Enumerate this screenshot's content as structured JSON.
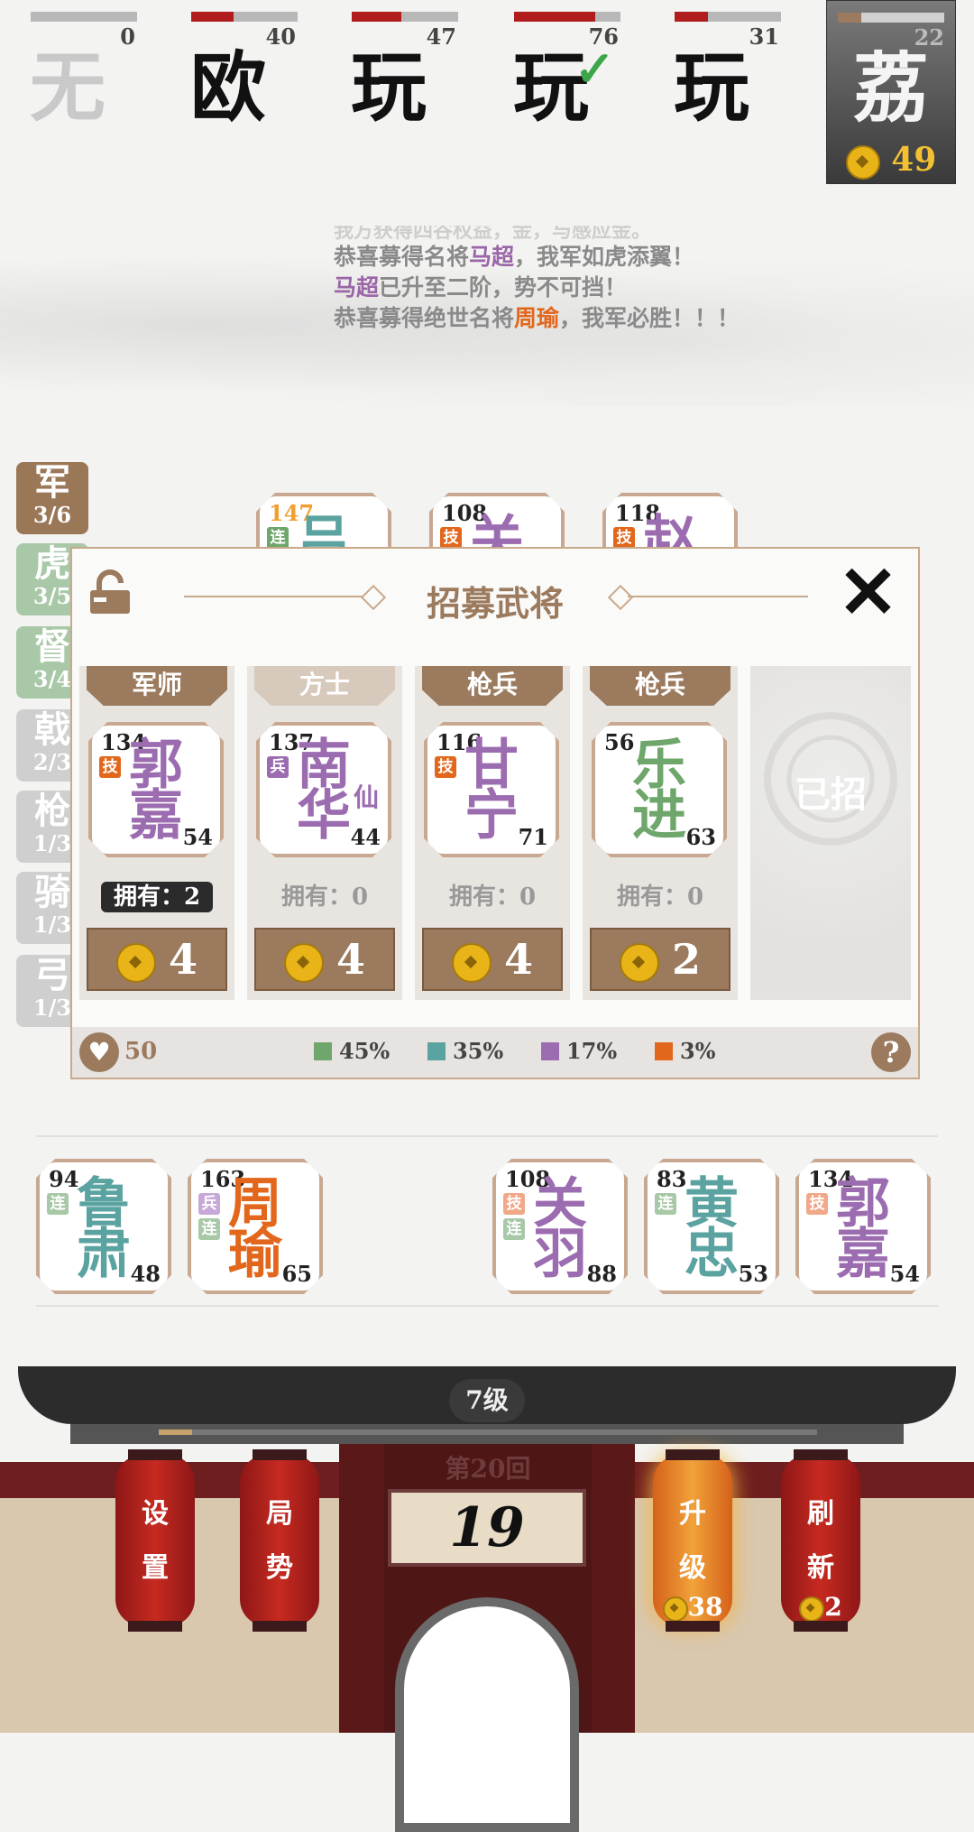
{
  "players": [
    {
      "hp": 0,
      "hp_pct": 0.0,
      "name": "无",
      "dim": true,
      "check": false
    },
    {
      "hp": 40,
      "hp_pct": 0.4,
      "name": "欧",
      "dim": false,
      "check": false
    },
    {
      "hp": 47,
      "hp_pct": 0.47,
      "name": "玩",
      "dim": false,
      "check": false
    },
    {
      "hp": 76,
      "hp_pct": 0.76,
      "name": "玩",
      "dim": false,
      "check": true
    },
    {
      "hp": 31,
      "hp_pct": 0.31,
      "name": "玩",
      "dim": false,
      "check": false
    }
  ],
  "self_player": {
    "hp": 22,
    "hp_pct": 0.22,
    "name": "荔",
    "coins": "49"
  },
  "log": {
    "line0": "我方获得四谷权益，金，与感应金。",
    "line1_a": "恭喜募得名将",
    "line1_b": "马超",
    "line1_c": "，我军如虎添翼！",
    "line2_a": "马超",
    "line2_b": "已升至二阶，势不可挡！",
    "line3_a": "恭喜募得绝世名将",
    "line3_b": "周瑜",
    "line3_c": "，我军必胜！！！"
  },
  "tabs": [
    {
      "label": "军",
      "count": "3/6"
    },
    {
      "label": "虎",
      "count": "3/5"
    },
    {
      "label": "督",
      "count": "3/4"
    },
    {
      "label": "戟",
      "count": "2/3"
    },
    {
      "label": "枪",
      "count": "1/3"
    },
    {
      "label": "骑",
      "count": "1/3"
    },
    {
      "label": "弓",
      "count": "1/3"
    }
  ],
  "board_top": [
    {
      "num": "147",
      "name": "吕",
      "badge": "连"
    },
    {
      "num": "108",
      "name": "关",
      "badge": "技"
    },
    {
      "num": "118",
      "name": "赵",
      "badge": "技"
    }
  ],
  "modal": {
    "title": "招募武将",
    "slots": [
      {
        "role": "军师",
        "num": "134",
        "badge": "技",
        "name": "郭\n嘉",
        "stat": "54",
        "owned": "拥有：2",
        "cost": "4"
      },
      {
        "role": "方士",
        "num": "137",
        "badge": "兵",
        "name": "南\n华",
        "sub": "仙",
        "stat": "44",
        "owned": "拥有：0",
        "cost": "4"
      },
      {
        "role": "枪兵",
        "num": "116",
        "badge": "技",
        "name": "甘\n宁",
        "stat": "71",
        "owned": "拥有：0",
        "cost": "4"
      },
      {
        "role": "枪兵",
        "num": "56",
        "badge": "",
        "name": "乐\n进",
        "stat": "63",
        "owned": "拥有：0",
        "cost": "2"
      }
    ],
    "recruited_label": "已招",
    "hearts": "50",
    "odds": [
      {
        "color": "#6fa66c",
        "pct": "45%"
      },
      {
        "color": "#5ba3a0",
        "pct": "35%"
      },
      {
        "color": "#9c6cb0",
        "pct": "17%"
      },
      {
        "color": "#e2671c",
        "pct": "3%"
      }
    ],
    "help": "?"
  },
  "bench": [
    {
      "num": "94",
      "name": "鲁\n肃",
      "stat": "48",
      "b1": "连",
      "b2": ""
    },
    {
      "num": "163",
      "name": "周\n瑜",
      "stat": "65",
      "b1": "兵",
      "b2": "连"
    },
    {
      "num": "108",
      "name": "关\n羽",
      "stat": "88",
      "b1": "技",
      "b2": "连"
    },
    {
      "num": "83",
      "name": "黄\n忠",
      "stat": "53",
      "b1": "连",
      "b2": ""
    },
    {
      "num": "134",
      "name": "郭\n嘉",
      "stat": "54",
      "b1": "技",
      "b2": ""
    }
  ],
  "building": {
    "level": "7级",
    "xp_pct": 0.05,
    "round": "第20回",
    "timer": "19",
    "settings": {
      "a": "设",
      "b": "置"
    },
    "situation": {
      "a": "局",
      "b": "势"
    },
    "upgrade": {
      "a": "升",
      "b": "级",
      "cost": "38"
    },
    "refresh": {
      "a": "刷",
      "b": "新",
      "cost": "2"
    }
  }
}
